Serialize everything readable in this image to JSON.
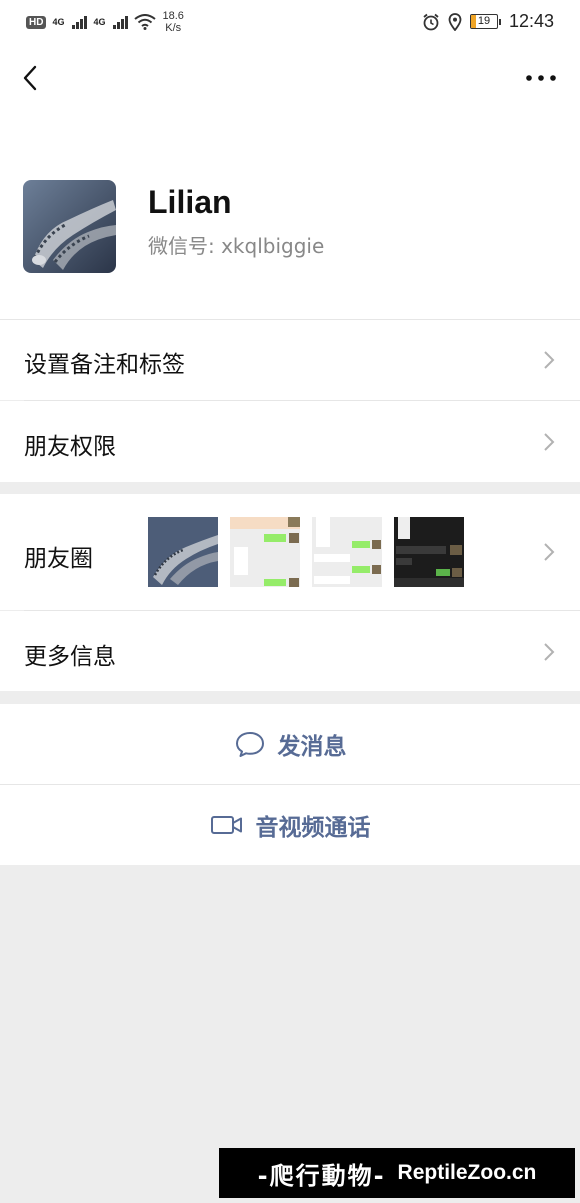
{
  "status_bar": {
    "hd": "HD",
    "network_1": "4G",
    "network_2": "4G",
    "speed_value": "18.6",
    "speed_unit": "K/s",
    "battery_level": "19",
    "time": "12:43"
  },
  "profile": {
    "name": "Lilian",
    "wechat_id": "微信号:  xkqlbiggie"
  },
  "rows": {
    "remark_tags": "设置备注和标签",
    "friend_permissions": "朋友权限",
    "moments": "朋友圈",
    "more_info": "更多信息"
  },
  "actions": {
    "send_message": "发消息",
    "video_call": "音视频通话"
  },
  "colors": {
    "link_blue": "#576b95",
    "background": "#ededed",
    "battery": "#f0a526"
  },
  "watermark": {
    "cn": "-爬行動物-",
    "en": "ReptileZoo.cn"
  }
}
